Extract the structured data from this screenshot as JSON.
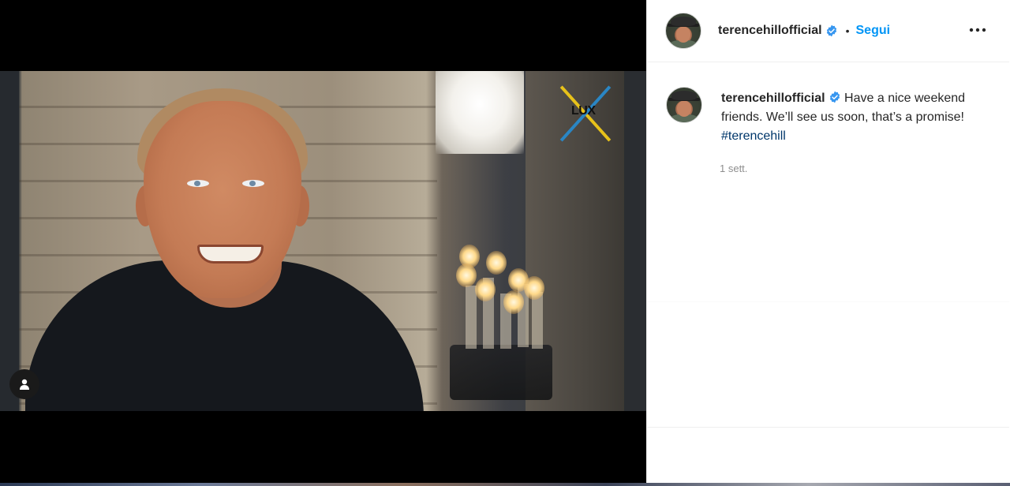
{
  "post": {
    "username": "terencehillofficial",
    "follow_label": "Segui",
    "separator": "•",
    "caption_text": "Have a nice weekend friends. We’ll see us soon, that’s a promise!",
    "hashtag": "#terencehill",
    "timestamp": "1 sett."
  },
  "media": {
    "logo_text": "LUX"
  },
  "icons": {
    "verified": "verified-badge-icon",
    "more": "more-options-icon",
    "tagged": "user-tag-icon"
  },
  "colors": {
    "link_blue": "#0095f6",
    "hashtag_blue": "#00376b",
    "verified_blue": "#3897f0",
    "muted": "#8e8e8e"
  }
}
